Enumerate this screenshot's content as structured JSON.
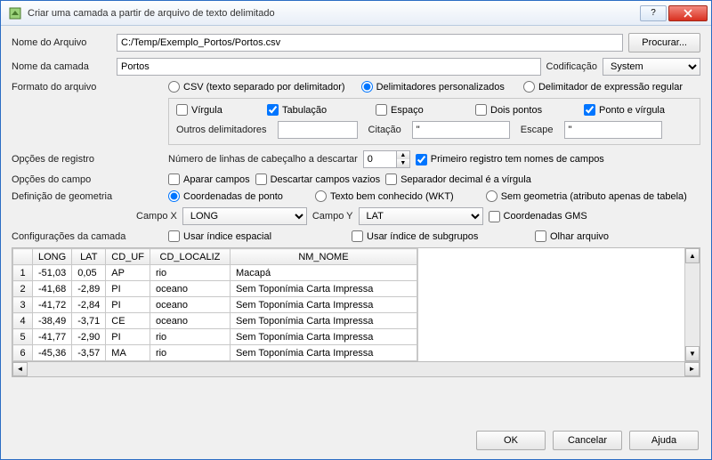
{
  "window": {
    "title": "Criar uma camada a partir de arquivo de texto delimitado"
  },
  "file": {
    "label": "Nome do Arquivo",
    "value": "C:/Temp/Exemplo_Portos/Portos.csv",
    "browse": "Procurar..."
  },
  "layer": {
    "label": "Nome da camada",
    "value": "Portos",
    "encoding_label": "Codificação",
    "encoding_value": "System"
  },
  "format": {
    "label": "Formato do arquivo",
    "csv": "CSV (texto separado por delimitador)",
    "custom": "Delimitadores personalizados",
    "regex": "Delimitador de expressão regular"
  },
  "delims": {
    "comma": "Vírgula",
    "tab": "Tabulação",
    "space": "Espaço",
    "colon": "Dois pontos",
    "semicolon": "Ponto e vírgula",
    "other_label": "Outros delimitadores",
    "other_value": "",
    "quote_label": "Citação",
    "quote_value": "\"",
    "escape_label": "Escape",
    "escape_value": "\""
  },
  "record": {
    "label": "Opções de registro",
    "skip_label": "Número de linhas de cabeçalho a descartar",
    "skip_value": "0",
    "first_has_names": "Primeiro registro tem nomes de campos"
  },
  "field": {
    "label": "Opções do campo",
    "trim": "Aparar campos",
    "discard_empty": "Descartar campos vazios",
    "decimal_comma": "Separador decimal é a vírgula"
  },
  "geom": {
    "label": "Definição de geometria",
    "point": "Coordenadas de ponto",
    "wkt": "Texto bem conhecido (WKT)",
    "none": "Sem geometria (atributo apenas de tabela)",
    "x_label": "Campo X",
    "x_value": "LONG",
    "y_label": "Campo Y",
    "y_value": "LAT",
    "dms": "Coordenadas GMS"
  },
  "layer_settings": {
    "label": "Configurações da camada",
    "spatial_index": "Usar índice espacial",
    "subset_index": "Usar índice de subgrupos",
    "watch_file": "Olhar arquivo"
  },
  "table": {
    "headers": [
      "",
      "LONG",
      "LAT",
      "CD_UF",
      "CD_LOCALIZ",
      "NM_NOME"
    ],
    "rows": [
      [
        "1",
        "-51,03",
        "0,05",
        "AP",
        "rio",
        "Macapá"
      ],
      [
        "2",
        "-41,68",
        "-2,89",
        "PI",
        "oceano",
        "Sem Toponímia Carta Impressa"
      ],
      [
        "3",
        "-41,72",
        "-2,84",
        "PI",
        "oceano",
        "Sem Toponímia Carta Impressa"
      ],
      [
        "4",
        "-38,49",
        "-3,71",
        "CE",
        "oceano",
        "Sem Toponímia Carta Impressa"
      ],
      [
        "5",
        "-41,77",
        "-2,90",
        "PI",
        "rio",
        "Sem Toponímia Carta Impressa"
      ],
      [
        "6",
        "-45,36",
        "-3,57",
        "MA",
        "rio",
        "Sem Toponímia Carta Impressa"
      ]
    ]
  },
  "buttons": {
    "ok": "OK",
    "cancel": "Cancelar",
    "help": "Ajuda"
  }
}
